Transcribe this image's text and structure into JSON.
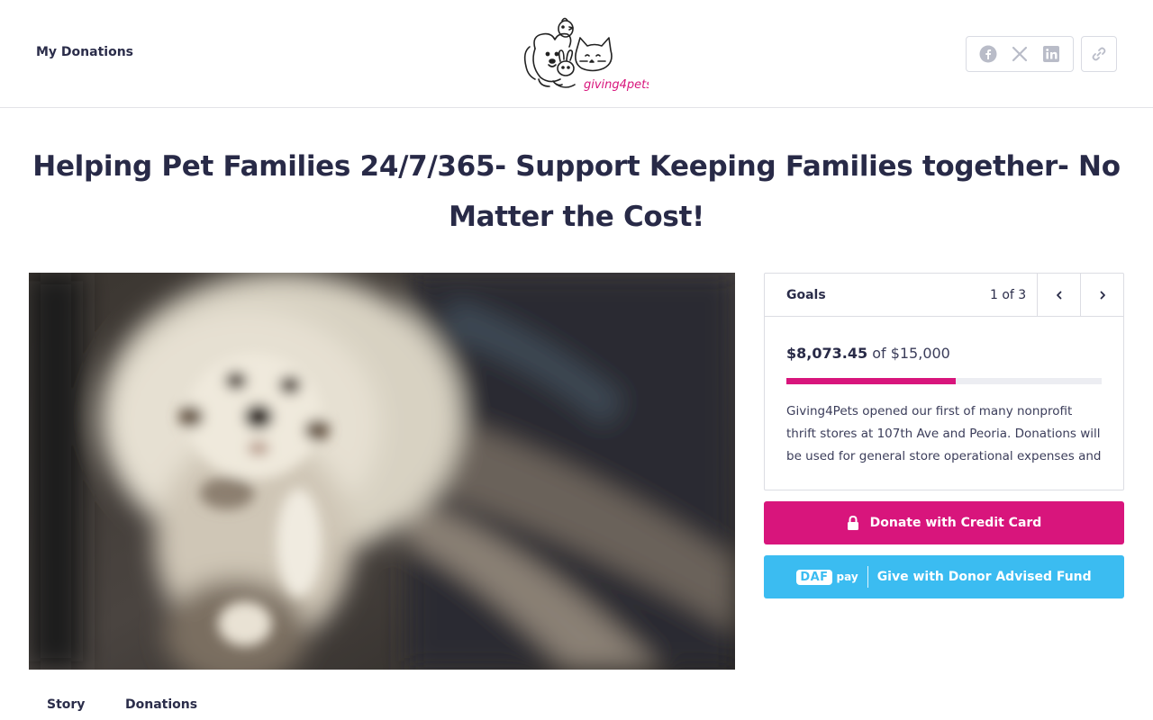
{
  "header": {
    "my_donations_label": "My Donations",
    "logo_text": "giving4pets",
    "share_icons": [
      "facebook-icon",
      "x-icon",
      "linkedin-icon"
    ],
    "copy_link_icon": "link-icon"
  },
  "campaign": {
    "title": "Helping Pet Families 24/7/365- Support Keeping Families together- No Matter the Cost!"
  },
  "goals": {
    "label": "Goals",
    "count": "1 of 3",
    "raised": "$8,073.45",
    "of_text": "of $15,000",
    "progress_fraction": 0.538,
    "description": "Giving4Pets opened our first of many nonprofit thrift stores at 107th Ave and Peoria. Donations will be used for general store operational expenses and al..."
  },
  "actions": {
    "credit_label": "Donate with Credit Card",
    "daf_badge": "DAF",
    "daf_pay": "pay",
    "daf_label": "Give with Donor Advised Fund"
  },
  "tabs": [
    {
      "label": "Story"
    },
    {
      "label": "Donations"
    }
  ],
  "colors": {
    "brand_pink": "#d8157c",
    "daf_blue": "#3bbcf1",
    "text_dark": "#282a47"
  }
}
